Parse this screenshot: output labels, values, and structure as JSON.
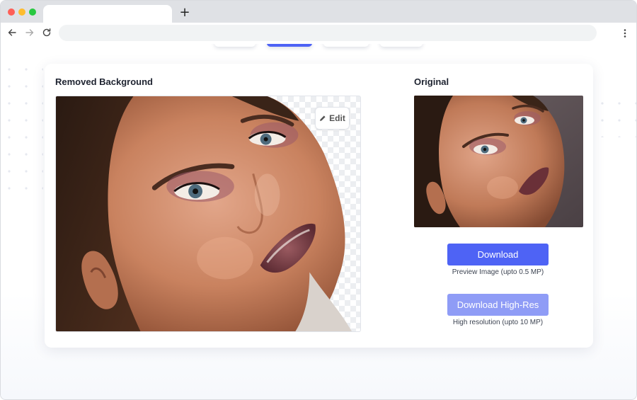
{
  "browser": {
    "new_tab_symbol": "+",
    "address_value": "",
    "icons": [
      "back-arrow-icon",
      "forward-arrow-icon",
      "reload-icon",
      "more-vert-icon"
    ]
  },
  "colors": {
    "accent": "#4e63f5",
    "accent_light": "#8f9cf6",
    "title_text": "#1e2330",
    "checker": "#eceef1"
  },
  "panel": {
    "removed_title": "Removed Background",
    "original_title": "Original",
    "edit_label": "Edit",
    "edit_icon": "pencil-icon"
  },
  "download": {
    "button_label": "Download",
    "caption": "Preview Image (upto 0.5 MP)"
  },
  "download_highres": {
    "button_label": "Download High-Res",
    "caption": "High resolution (upto 10 MP)"
  }
}
